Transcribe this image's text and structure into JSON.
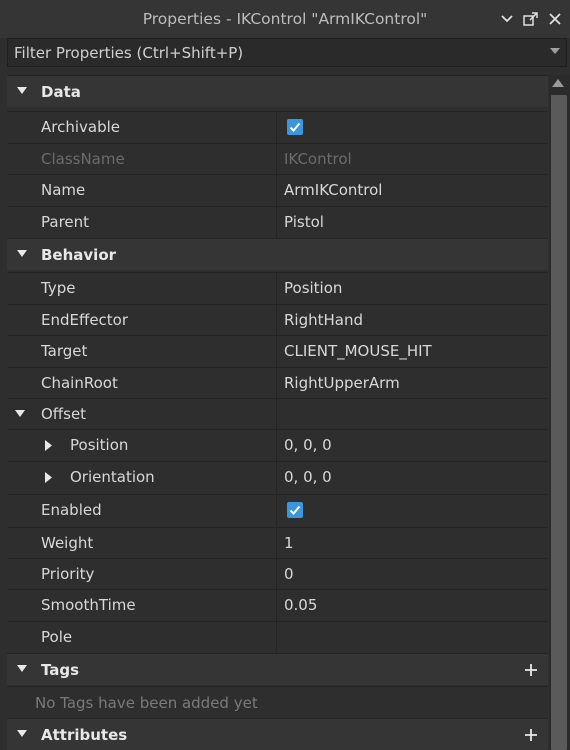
{
  "window": {
    "title": "Properties - IKControl \"ArmIKControl\""
  },
  "filter": {
    "placeholder": "Filter Properties (Ctrl+Shift+P)"
  },
  "sections": {
    "data": "Data",
    "behavior": "Behavior",
    "tags": "Tags",
    "attributes": "Attributes"
  },
  "properties": {
    "archivable": {
      "name": "Archivable",
      "checked": true
    },
    "classname": {
      "name": "ClassName",
      "value": "IKControl"
    },
    "name": {
      "name": "Name",
      "value": "ArmIKControl"
    },
    "parent": {
      "name": "Parent",
      "value": "Pistol"
    },
    "type": {
      "name": "Type",
      "value": "Position"
    },
    "endeffector": {
      "name": "EndEffector",
      "value": "RightHand"
    },
    "target": {
      "name": "Target",
      "value": "CLIENT_MOUSE_HIT"
    },
    "chainroot": {
      "name": "ChainRoot",
      "value": "RightUpperArm"
    },
    "offset": {
      "name": "Offset"
    },
    "position": {
      "name": "Position",
      "value": "0, 0, 0"
    },
    "orientation": {
      "name": "Orientation",
      "value": "0, 0, 0"
    },
    "enabled": {
      "name": "Enabled",
      "checked": true
    },
    "weight": {
      "name": "Weight",
      "value": "1"
    },
    "priority": {
      "name": "Priority",
      "value": "0"
    },
    "smoothtime": {
      "name": "SmoothTime",
      "value": "0.05"
    },
    "pole": {
      "name": "Pole",
      "value": ""
    }
  },
  "tags": {
    "empty_message": "No Tags have been added yet"
  },
  "colors": {
    "background": "#2e2e2e",
    "section_header": "#353535",
    "checkbox_accent": "#3a96dd",
    "disabled_text": "#6b6b6b"
  },
  "icons": {
    "collapse": "caret-down-icon",
    "expand": "caret-right-icon",
    "add": "plus-icon",
    "checkbox": "checkmark-icon"
  }
}
